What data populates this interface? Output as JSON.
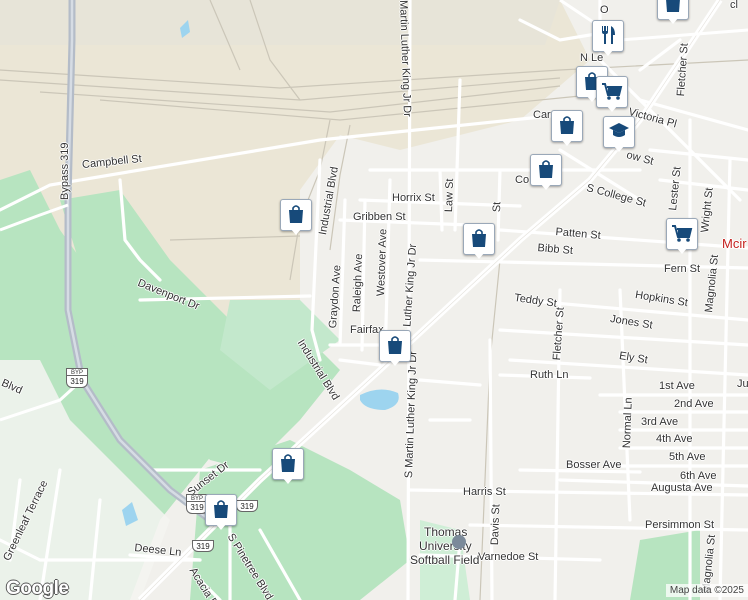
{
  "map": {
    "streets": {
      "bypass": "Bypass 319",
      "campbell": "Campbell St",
      "industrial_blvd_north": "Industrial Blvd",
      "industrial_blvd_south": "Industrial Blvd",
      "davenport": "Davenport Dr",
      "graydon": "Graydon Ave",
      "raleigh": "Raleigh Ave",
      "westover": "Westover Ave",
      "mlk_north": "Martin Luther King Jr Dr",
      "mlk_mid": "Martin Luther King Jr Dr",
      "mlk_south": "S Martin Luther King Jr Dr",
      "horrix": "Horrix St",
      "gribben": "Gribben St",
      "law": "Law St",
      "fairfax": "Fairfax",
      "patten": "Patten St",
      "bibb": "Bibb St",
      "teddy": "Teddy St",
      "fletcher_south": "Fletcher St",
      "fletcher_north": "Fletcher St",
      "hopkins": "Hopkins St",
      "jones": "Jones St",
      "ely": "Ely St",
      "ruth": "Ruth Ln",
      "first_ave": "1st Ave",
      "second_ave": "2nd Ave",
      "third_ave": "3rd Ave",
      "fourth_ave": "4th Ave",
      "fifth_ave": "5th Ave",
      "sixth_ave": "6th Ave",
      "augusta": "Augusta Ave",
      "normal": "Normal Ln",
      "bosser": "Bosser Ave",
      "harris": "Harris St",
      "davis": "Davis St",
      "persimmon": "Persimmon St",
      "varnedoe": "Varnedoe St",
      "magnolia": "Magnolia St",
      "lester": "Lester St",
      "wright": "Wright St",
      "fern": "Fern St",
      "college": "S College St",
      "victoria": "Victoria Pl",
      "n_le": "N Le",
      "ow": "ow St",
      "car": "Car",
      "co": "Co",
      "sunset": "Sunset Dr",
      "greenleaf": "Greenleaf Terrace",
      "deese": "Deese Ln",
      "acacia": "Acacia B",
      "pinetree": "S Pinetree Blvd",
      "blvd_west": "Blvd",
      "ju": "Ju",
      "st_right": "St"
    },
    "places": {
      "softball": "Thomas University Softball Field",
      "softball_line1": "Thomas",
      "softball_line2": "University",
      "softball_line3": "Softball Field",
      "city_partial": "Mcir",
      "top_partial": "O",
      "top_right_partial": "cl"
    },
    "shields": [
      {
        "top": "BYP",
        "num": "319"
      },
      {
        "top": "BYP",
        "num": "319"
      },
      {
        "top": "",
        "num": "319"
      },
      {
        "top": "",
        "num": "319"
      }
    ],
    "pins": [
      {
        "kind": "shopping",
        "icon": "shopping-bag-icon"
      },
      {
        "kind": "shopping",
        "icon": "shopping-bag-icon"
      },
      {
        "kind": "shopping",
        "icon": "shopping-bag-icon"
      },
      {
        "kind": "shopping",
        "icon": "shopping-bag-icon"
      },
      {
        "kind": "shopping",
        "icon": "shopping-bag-icon"
      },
      {
        "kind": "shopping",
        "icon": "shopping-bag-icon"
      },
      {
        "kind": "shopping",
        "icon": "shopping-bag-icon"
      },
      {
        "kind": "grocery",
        "icon": "shopping-cart-icon"
      },
      {
        "kind": "grocery",
        "icon": "shopping-cart-icon"
      },
      {
        "kind": "restaurant",
        "icon": "fork-knife-icon"
      },
      {
        "kind": "school",
        "icon": "graduation-cap-icon"
      }
    ],
    "colors": {
      "park": "#b7e4c0",
      "industrial": "#ebe6d6",
      "water": "#9dd4ef",
      "road": "#ffffff",
      "highway": "#b4bcc8",
      "pin_icon": "#174a7a"
    },
    "google_logo": "Google",
    "attribution": "Map data ©2025"
  }
}
